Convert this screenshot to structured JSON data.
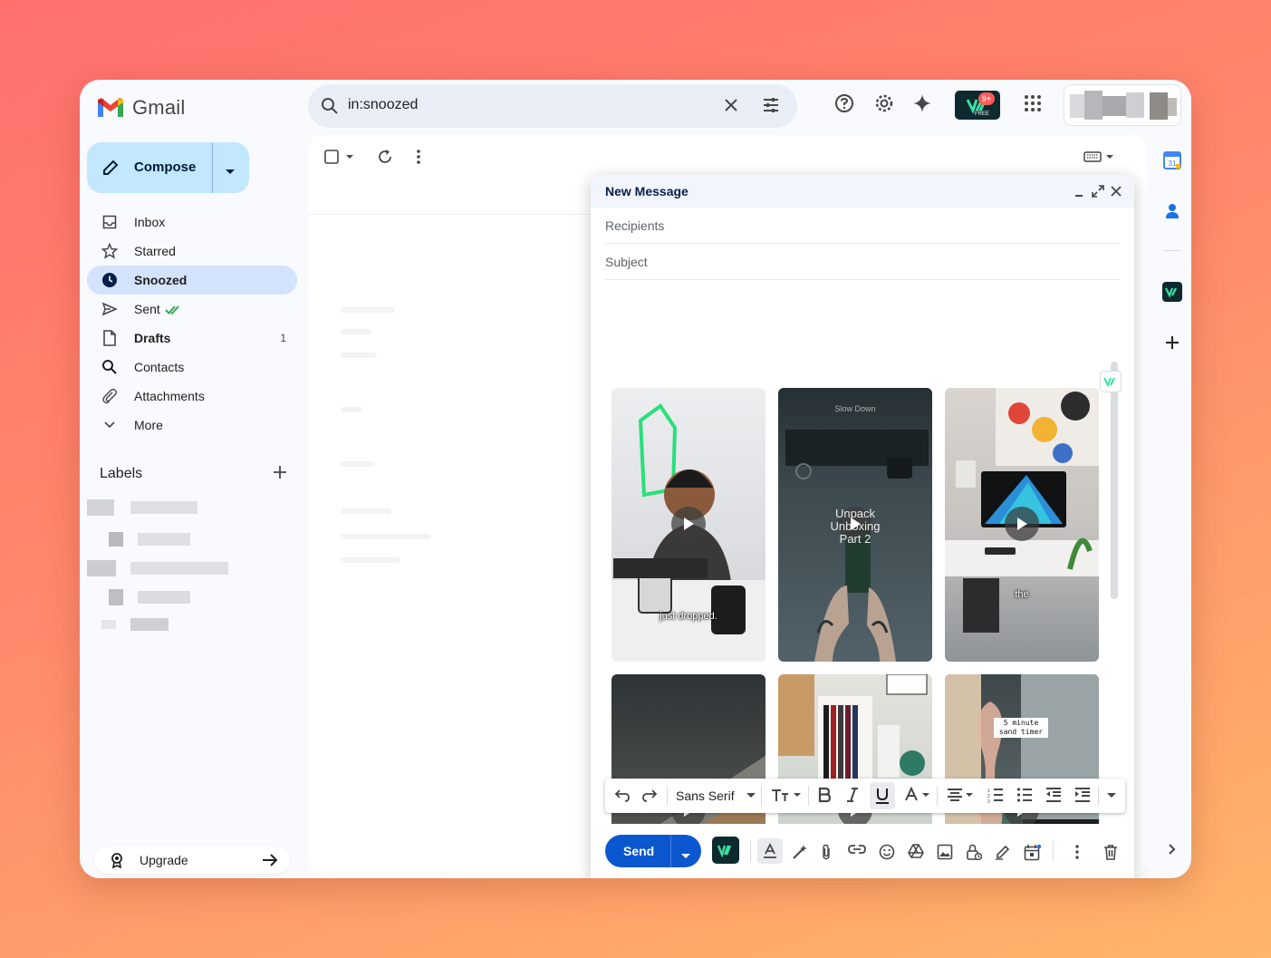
{
  "app": {
    "name": "Gmail"
  },
  "search": {
    "value": "in:snoozed"
  },
  "extension": {
    "badge_count": "9+",
    "badge_sub": "FREE"
  },
  "compose_button": {
    "label": "Compose"
  },
  "nav": {
    "items": [
      {
        "label": "Inbox",
        "icon": "inbox-icon",
        "count": ""
      },
      {
        "label": "Starred",
        "icon": "star-icon",
        "count": ""
      },
      {
        "label": "Snoozed",
        "icon": "clock-icon",
        "count": "",
        "active": true
      },
      {
        "label": "Sent",
        "icon": "send-icon",
        "count": ""
      },
      {
        "label": "Drafts",
        "icon": "draft-icon",
        "count": "1"
      },
      {
        "label": "Contacts",
        "icon": "search-icon",
        "count": ""
      },
      {
        "label": "Attachments",
        "icon": "paperclip-icon",
        "count": ""
      },
      {
        "label": "More",
        "icon": "chevron-down-icon",
        "count": ""
      }
    ]
  },
  "labels": {
    "title": "Labels"
  },
  "upgrade": {
    "label": "Upgrade"
  },
  "compose_window": {
    "title": "New Message",
    "recipients_placeholder": "Recipients",
    "subject_placeholder": "Subject",
    "videos": [
      {
        "caption": "just dropped.",
        "bg": [
          "#e9e9ea",
          "#cfcfd2"
        ]
      },
      {
        "caption": "Unpack Unboxing Part 2",
        "overlay_top": "Slow Down",
        "bg": [
          "#2b3538",
          "#55636a"
        ]
      },
      {
        "caption": "the",
        "bg": [
          "#d8d4d1",
          "#9aa0a4"
        ]
      },
      {
        "caption": "",
        "bg": [
          "#2f3436",
          "#8a7460"
        ]
      },
      {
        "caption": "",
        "bg": [
          "#d9dbd6",
          "#8f9a90"
        ]
      },
      {
        "caption": "",
        "label": "5 minute sand timer",
        "bg": [
          "#3e4a4c",
          "#1a9b6d"
        ]
      }
    ],
    "format": {
      "font": "Sans Serif"
    },
    "send_label": "Send"
  },
  "colors": {
    "accent": "#0b57d0",
    "active_nav": "#d3e3fd",
    "compose": "#c2e7ff"
  }
}
